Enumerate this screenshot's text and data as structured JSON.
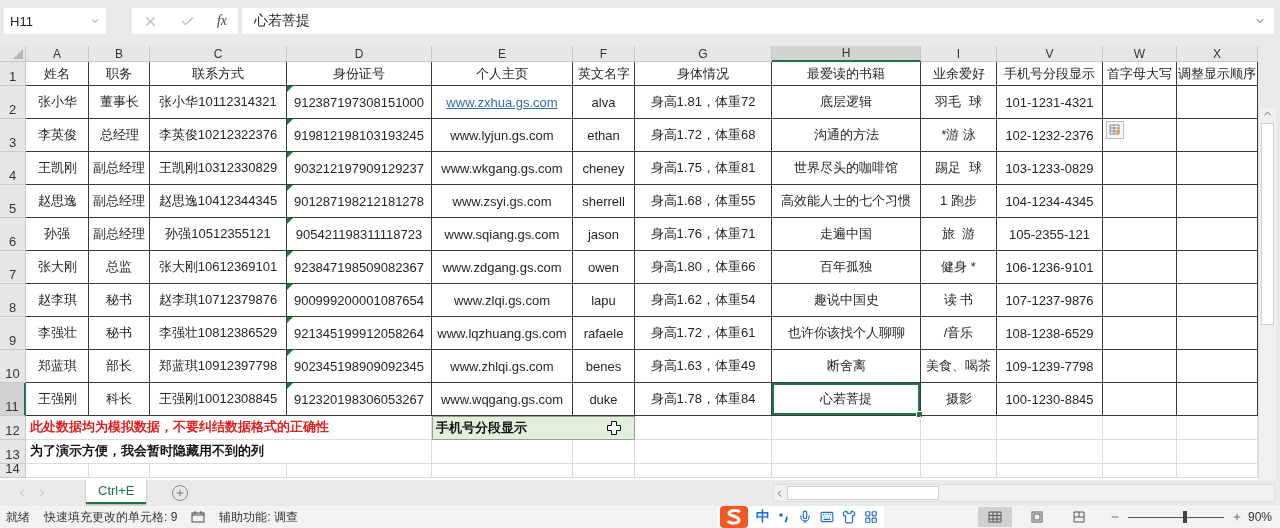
{
  "name_box": "H11",
  "function_button": "fx",
  "formula": "心若菩提",
  "columns": [
    {
      "label": "A",
      "selected": false
    },
    {
      "label": "B",
      "selected": false
    },
    {
      "label": "C",
      "selected": false
    },
    {
      "label": "D",
      "selected": false
    },
    {
      "label": "E",
      "selected": false
    },
    {
      "label": "F",
      "selected": false
    },
    {
      "label": "G",
      "selected": false
    },
    {
      "label": "H",
      "selected": true
    },
    {
      "label": "I",
      "selected": false
    },
    {
      "label": "V",
      "selected": false
    },
    {
      "label": "W",
      "selected": false
    },
    {
      "label": "X",
      "selected": false
    }
  ],
  "rows": [
    {
      "kind": "header",
      "number": "1",
      "selected": false,
      "cells": [
        {
          "text": "姓名"
        },
        {
          "text": "职务"
        },
        {
          "text": "联系方式"
        },
        {
          "text": "身份证号"
        },
        {
          "text": "个人主页"
        },
        {
          "text": "英文名字"
        },
        {
          "text": "身体情况"
        },
        {
          "text": "最爱读的书籍"
        },
        {
          "text": "业余爱好"
        },
        {
          "text": "手机号分段显示"
        },
        {
          "text": "首字母大写"
        },
        {
          "text": "调整显示顺序"
        }
      ]
    },
    {
      "kind": "data",
      "number": "2",
      "selected": false,
      "cells": [
        {
          "text": "张小华"
        },
        {
          "text": "董事长"
        },
        {
          "text": "张小华10112314321"
        },
        {
          "text": "912387197308151000",
          "flag": true
        },
        {
          "text": "www.zxhua.gs.com",
          "link": true
        },
        {
          "text": "alva"
        },
        {
          "text": "身高1.81，体重72"
        },
        {
          "text": "底层逻辑"
        },
        {
          "text": "羽毛  球"
        },
        {
          "text": "101-1231-4321"
        }
      ]
    },
    {
      "kind": "data",
      "number": "3",
      "selected": false,
      "cells": [
        {
          "text": "李英俊"
        },
        {
          "text": "总经理"
        },
        {
          "text": "李英俊10212322376"
        },
        {
          "text": "919812198103193245",
          "flag": true
        },
        {
          "text": "www.lyjun.gs.com"
        },
        {
          "text": "ethan"
        },
        {
          "text": "身高1.72，体重68"
        },
        {
          "text": "沟通的方法"
        },
        {
          "text": "*游 泳"
        },
        {
          "text": "102-1232-2376"
        },
        {
          "smart_tag": true
        }
      ]
    },
    {
      "kind": "data",
      "number": "4",
      "selected": false,
      "cells": [
        {
          "text": "王凯刚"
        },
        {
          "text": "副总经理"
        },
        {
          "text": "王凯刚10312330829"
        },
        {
          "text": "903212197909129237",
          "flag": true
        },
        {
          "text": "www.wkgang.gs.com"
        },
        {
          "text": "cheney"
        },
        {
          "text": "身高1.75，体重81"
        },
        {
          "text": "世界尽头的咖啡馆"
        },
        {
          "text": "踢足  球"
        },
        {
          "text": "103-1233-0829"
        }
      ]
    },
    {
      "kind": "data",
      "number": "5",
      "selected": false,
      "cells": [
        {
          "text": "赵思逸"
        },
        {
          "text": "副总经理"
        },
        {
          "text": "赵思逸10412344345"
        },
        {
          "text": "901287198212181278",
          "flag": true
        },
        {
          "text": "www.zsyi.gs.com"
        },
        {
          "text": "sherrell"
        },
        {
          "text": "身高1.68，体重55"
        },
        {
          "text": "高效能人士的七个习惯"
        },
        {
          "text": "1 跑步"
        },
        {
          "text": "104-1234-4345"
        }
      ]
    },
    {
      "kind": "data",
      "number": "6",
      "selected": false,
      "cells": [
        {
          "text": "孙强"
        },
        {
          "text": "副总经理"
        },
        {
          "text": "孙强10512355121"
        },
        {
          "text": "905421198311118723",
          "flag": true
        },
        {
          "text": "www.sqiang.gs.com"
        },
        {
          "text": "jason"
        },
        {
          "text": "身高1.76，体重71"
        },
        {
          "text": "走遍中国"
        },
        {
          "text": "旅  游"
        },
        {
          "text": "105-2355-121"
        }
      ]
    },
    {
      "kind": "data",
      "number": "7",
      "selected": false,
      "cells": [
        {
          "text": "张大刚"
        },
        {
          "text": "总监"
        },
        {
          "text": "张大刚10612369101"
        },
        {
          "text": "923847198509082367",
          "flag": true
        },
        {
          "text": "www.zdgang.gs.com"
        },
        {
          "text": "owen"
        },
        {
          "text": "身高1.80，体重66"
        },
        {
          "text": "百年孤独"
        },
        {
          "text": "健身 *"
        },
        {
          "text": "106-1236-9101"
        }
      ]
    },
    {
      "kind": "data",
      "number": "8",
      "selected": false,
      "cells": [
        {
          "text": "赵李琪"
        },
        {
          "text": "秘书"
        },
        {
          "text": "赵李琪10712379876"
        },
        {
          "text": "900999200001087654",
          "flag": true
        },
        {
          "text": "www.zlqi.gs.com"
        },
        {
          "text": "lapu"
        },
        {
          "text": "身高1.62，体重54"
        },
        {
          "text": "趣说中国史"
        },
        {
          "text": "读 书"
        },
        {
          "text": "107-1237-9876"
        }
      ]
    },
    {
      "kind": "data",
      "number": "9",
      "selected": false,
      "cells": [
        {
          "text": "李强壮"
        },
        {
          "text": "秘书"
        },
        {
          "text": "李强壮10812386529"
        },
        {
          "text": "921345199912058264",
          "flag": true
        },
        {
          "text": "www.lqzhuang.gs.com"
        },
        {
          "text": "rafaele"
        },
        {
          "text": "身高1.72，体重61"
        },
        {
          "text": "也许你该找个人聊聊"
        },
        {
          "text": "/音乐"
        },
        {
          "text": "108-1238-6529"
        }
      ]
    },
    {
      "kind": "data",
      "number": "10",
      "selected": false,
      "cells": [
        {
          "text": "郑蓝琪"
        },
        {
          "text": "部长"
        },
        {
          "text": "郑蓝琪10912397798"
        },
        {
          "text": "902345198909092345",
          "flag": true
        },
        {
          "text": "www.zhlqi.gs.com"
        },
        {
          "text": "benes"
        },
        {
          "text": "身高1.63，体重49"
        },
        {
          "text": "断舍离"
        },
        {
          "text": "美食、喝茶"
        },
        {
          "text": "109-1239-7798"
        }
      ]
    },
    {
      "kind": "data",
      "number": "11",
      "selected": true,
      "cells": [
        {
          "text": "王强刚"
        },
        {
          "text": "科长"
        },
        {
          "text": "王强刚10012308845"
        },
        {
          "text": "912320198306053267",
          "flag": true
        },
        {
          "text": "www.wqgang.gs.com"
        },
        {
          "text": "duke"
        },
        {
          "text": "身高1.78，体重84"
        },
        {
          "text": "心若菩提",
          "selected": true
        },
        {
          "text": "摄影"
        },
        {
          "text": "100-1230-8845"
        }
      ]
    },
    {
      "kind": "note",
      "number": "12",
      "selected": false,
      "note": {
        "text": "此处数据均为模拟数据，不要纠结数据格式的正确性",
        "color": "#e02020"
      },
      "tag": {
        "text": "手机号分段显示"
      }
    },
    {
      "kind": "note",
      "number": "13",
      "selected": false,
      "note": {
        "text": "为了演示方便，我会暂时隐藏用不到的列",
        "color": "#111111"
      }
    },
    {
      "kind": "empty",
      "number": "14",
      "selected": false
    }
  ],
  "sheet_tabs": [
    {
      "label": "Ctrl+E",
      "selected": true
    }
  ],
  "status_bar": {
    "ready": "就绪",
    "flash_fill": "快速填充更改的单元格: 9",
    "accessibility": "辅助功能: 调查",
    "ime_mode": "中",
    "views": [
      {
        "kind": "normal",
        "selected": true
      },
      {
        "kind": "page-layout",
        "selected": false
      },
      {
        "kind": "page-break",
        "selected": false
      }
    ],
    "zoom": {
      "level": 0.57,
      "reading": "90%"
    }
  }
}
